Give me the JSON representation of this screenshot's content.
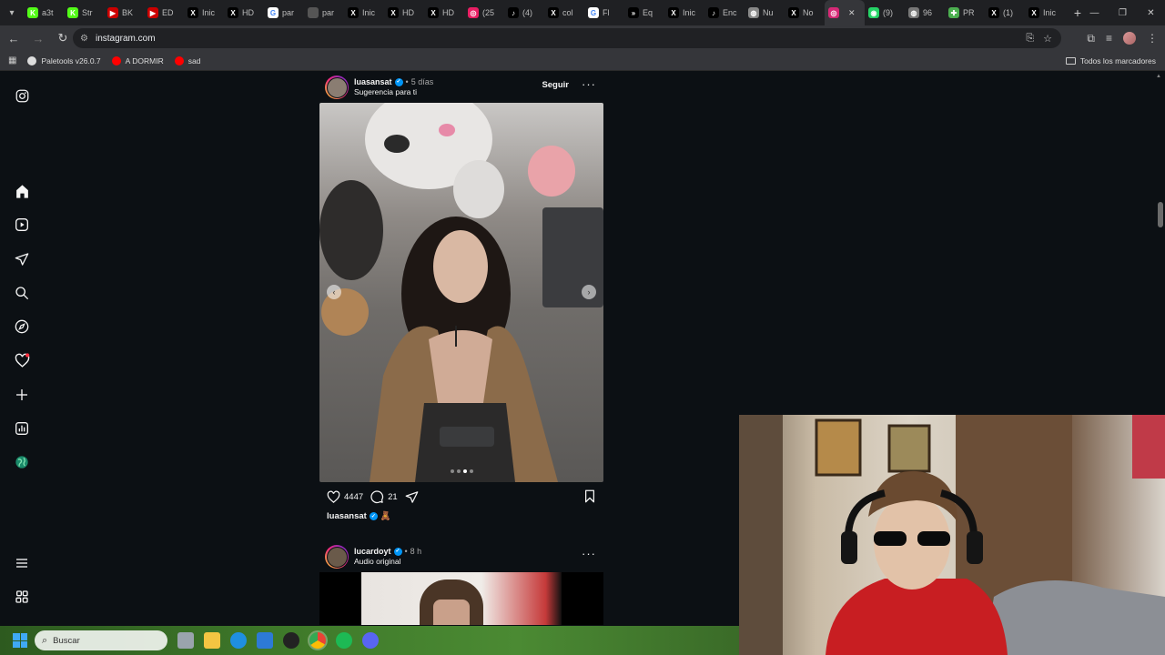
{
  "browser": {
    "tabs": [
      {
        "label": "a3t",
        "color": "#53fc18",
        "glyph": "K"
      },
      {
        "label": "Str",
        "color": "#53fc18",
        "glyph": "K"
      },
      {
        "label": "BK",
        "color": "#cc0000",
        "glyph": "▶"
      },
      {
        "label": "ED",
        "color": "#cc0000",
        "glyph": "▶"
      },
      {
        "label": "Inic",
        "color": "#000000",
        "glyph": "X"
      },
      {
        "label": "HD",
        "color": "#000000",
        "glyph": "X"
      },
      {
        "label": "par",
        "color": "#ffffff",
        "glyph": "G"
      },
      {
        "label": "par",
        "color": "#555555",
        "glyph": ""
      },
      {
        "label": "Inic",
        "color": "#000000",
        "glyph": "X"
      },
      {
        "label": "HD",
        "color": "#000000",
        "glyph": "X"
      },
      {
        "label": "HD",
        "color": "#000000",
        "glyph": "X"
      },
      {
        "label": "(25",
        "color": "#e91e63",
        "glyph": "◎"
      },
      {
        "label": "(4)",
        "color": "#000000",
        "glyph": "♪"
      },
      {
        "label": "col",
        "color": "#000000",
        "glyph": "X"
      },
      {
        "label": "Fl",
        "color": "#ffffff",
        "glyph": "G"
      },
      {
        "label": "Eq",
        "color": "#000000",
        "glyph": "»"
      },
      {
        "label": "Inic",
        "color": "#000000",
        "glyph": "X"
      },
      {
        "label": "Enc",
        "color": "#000000",
        "glyph": "♪"
      },
      {
        "label": "Nu",
        "color": "#888888",
        "glyph": "◍"
      },
      {
        "label": "No",
        "color": "#000000",
        "glyph": "X"
      },
      {
        "label": "",
        "color": "#d62976",
        "glyph": "◎",
        "active": true
      },
      {
        "label": "(9)",
        "color": "#25d366",
        "glyph": "◉"
      },
      {
        "label": "96",
        "color": "#777777",
        "glyph": "◍"
      },
      {
        "label": "PR",
        "color": "#4caf50",
        "glyph": "✚"
      },
      {
        "label": "(1)",
        "color": "#000000",
        "glyph": "X"
      },
      {
        "label": "Inic",
        "color": "#000000",
        "glyph": "X"
      }
    ],
    "url": "instagram.com",
    "bookmarks": [
      {
        "label": "Paletools v26.0.7",
        "color": "#dddddd"
      },
      {
        "label": "A DORMIR",
        "color": "#ff0000"
      },
      {
        "label": "sad",
        "color": "#ff0000"
      }
    ],
    "all_bookmarks_label": "Todos los marcadores"
  },
  "posts": [
    {
      "username": "luasansat",
      "time": "5 días",
      "subtitle": "Sugerencia para ti",
      "follow_label": "Seguir",
      "likes": "4447",
      "comments": "21",
      "caption_user": "luasansat",
      "caption_emoji": "🧸"
    },
    {
      "username": "lucardoyt",
      "time": "8 h",
      "subtitle": "Audio original"
    }
  ],
  "taskbar": {
    "search_placeholder": "Buscar"
  },
  "colors": {
    "background": "#0c1014",
    "verified": "#0095f6",
    "notification_dot": "#ff3040"
  }
}
